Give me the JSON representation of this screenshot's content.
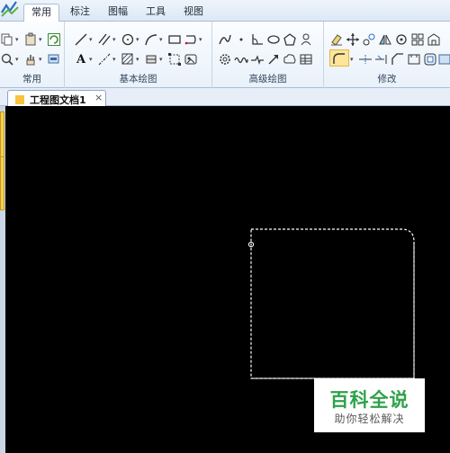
{
  "menu": {
    "tabs": [
      {
        "label": "常用",
        "active": true
      },
      {
        "label": "标注",
        "active": false
      },
      {
        "label": "图幅",
        "active": false
      },
      {
        "label": "工具",
        "active": false
      },
      {
        "label": "视图",
        "active": false
      }
    ]
  },
  "ribbon": {
    "groups": [
      {
        "label": "常用"
      },
      {
        "label": "基本绘图"
      },
      {
        "label": "高级绘图"
      },
      {
        "label": "修改"
      }
    ],
    "text_tool_glyph": "A"
  },
  "document": {
    "tab_title": "工程图文档1",
    "close_glyph": "×"
  },
  "canvas": {
    "background": "#000000",
    "shape_color": "#ffffff"
  },
  "watermark": {
    "brand": "百科全说",
    "slogan": "助你轻松解决",
    "brand_color": "#2ea24a"
  },
  "colors": {
    "ribbon_border": "#a8bfd9",
    "highlight": "#fde59a"
  }
}
